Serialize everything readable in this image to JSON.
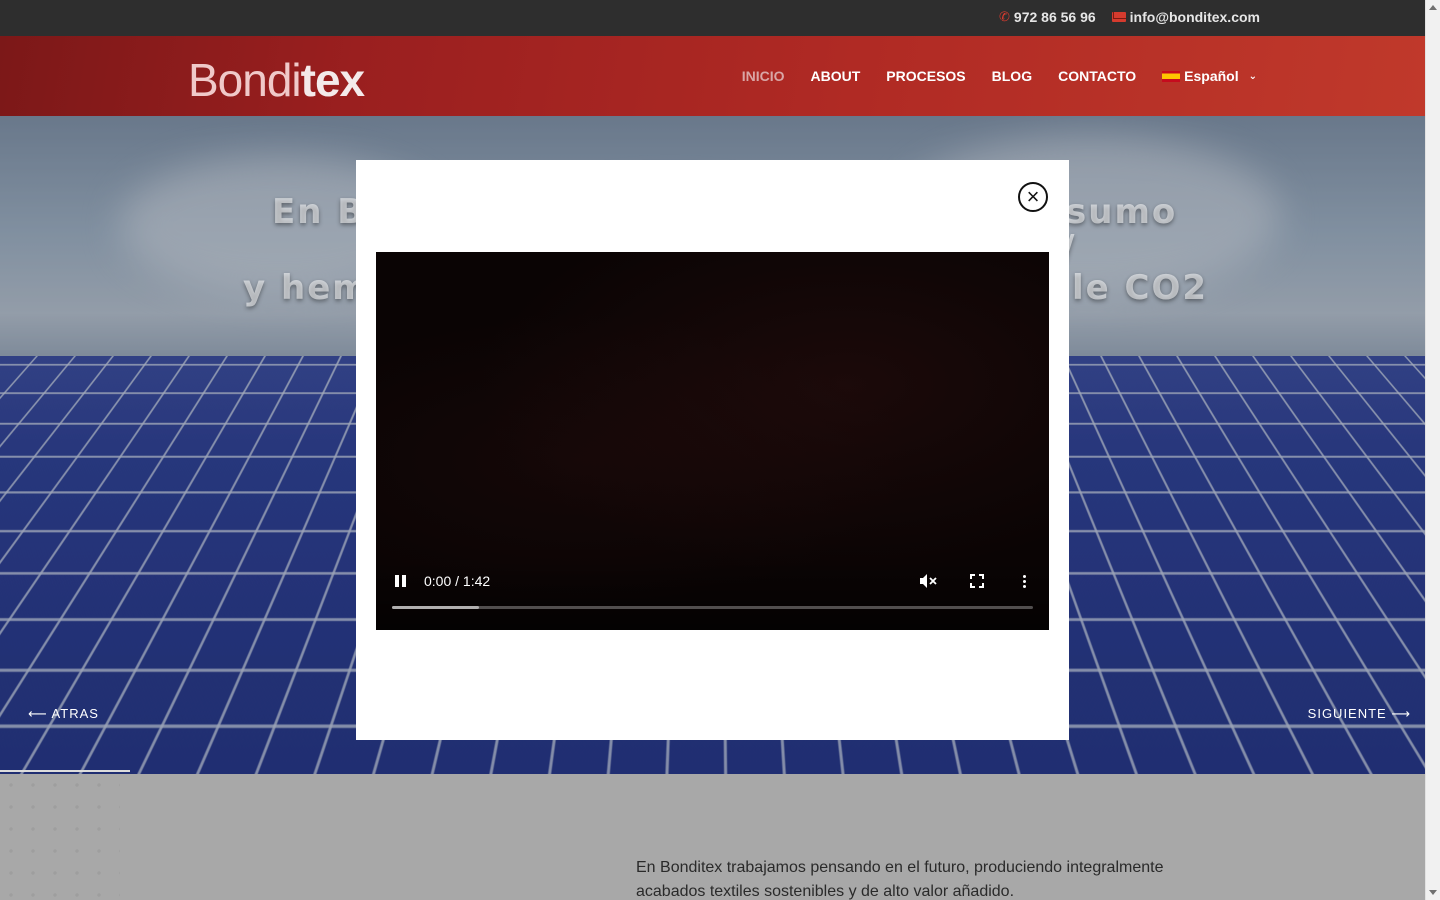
{
  "topbar": {
    "phone": "972 86 56 96",
    "email": "info@bonditex.com"
  },
  "header": {
    "logo_part1": "Bondi",
    "logo_part2": "tex",
    "nav": [
      {
        "label": "INICIO",
        "active": true
      },
      {
        "label": "ABOUT",
        "active": false
      },
      {
        "label": "PROCESOS",
        "active": false
      },
      {
        "label": "BLOG",
        "active": false
      },
      {
        "label": "CONTACTO",
        "active": false
      }
    ],
    "language": "Español"
  },
  "hero": {
    "line1_left": "En B",
    "line1_right": "sumo",
    "line2_right": "/",
    "line3_left": "y hem",
    "line3_right": "le CO2",
    "prev_label": "ATRAS",
    "next_label": "SIGUIENTE"
  },
  "video": {
    "time": "0:00 / 1:42",
    "progress_fraction": 0.135
  },
  "about": {
    "text": "En Bonditex trabajamos pensando en el futuro, produciendo integralmente acabados textiles sostenibles y de alto valor añadido."
  },
  "colors": {
    "header_red": "#b02a24",
    "topbar": "#2e2e2e",
    "accent": "#d63b2e"
  }
}
